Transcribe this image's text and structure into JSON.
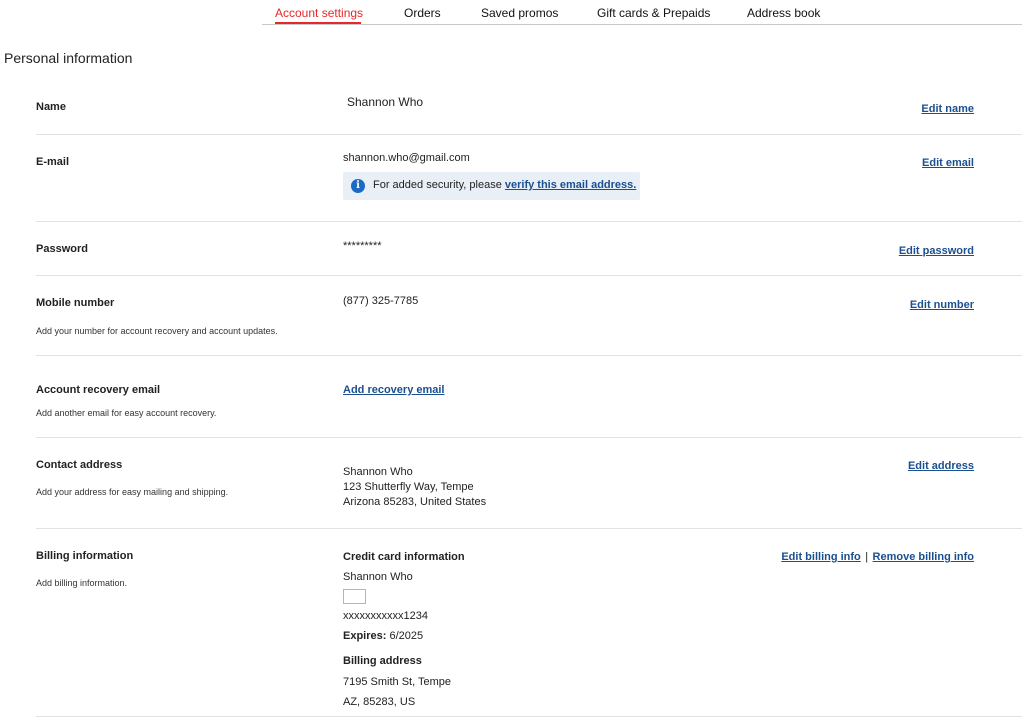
{
  "tabs": [
    {
      "label": "Account settings",
      "active": true
    },
    {
      "label": "Orders"
    },
    {
      "label": "Saved promos"
    },
    {
      "label": "Gift cards & Prepaids"
    },
    {
      "label": "Address book"
    }
  ],
  "section_title": "Personal information",
  "rows": {
    "name": {
      "label": "Name",
      "value": "Shannon Who",
      "action": "Edit name"
    },
    "email": {
      "label": "E-mail",
      "value": "shannon.who@gmail.com",
      "action": "Edit email",
      "notice_text": "For added security, please",
      "notice_link": "verify this email address."
    },
    "password": {
      "label": "Password",
      "value": "*********",
      "action": "Edit password"
    },
    "mobile": {
      "label": "Mobile number",
      "sub": "Add your number for account recovery and account updates.",
      "value": "(877) 325-7785",
      "action": "Edit number"
    },
    "recovery": {
      "label": "Account recovery email",
      "sub": "Add another email for easy account recovery.",
      "link": "Add recovery email"
    },
    "contact": {
      "label": "Contact address",
      "sub": "Add your address for easy mailing and shipping.",
      "lines": [
        "Shannon Who",
        "123 Shutterfly Way, Tempe",
        "Arizona 85283, United States"
      ],
      "action": "Edit address"
    },
    "billing": {
      "label": "Billing information",
      "sub": "Add billing information.",
      "cc_heading": "Credit card information",
      "cc_name": "Shannon Who",
      "cc_number": "xxxxxxxxxxx1234",
      "expires_label": "Expires:",
      "expires_value": "6/2025",
      "address_heading": "Billing address",
      "address_lines": [
        "7195 Smith St, Tempe",
        "AZ, 85283, US"
      ],
      "edit_action": "Edit billing info",
      "separator": "|",
      "remove_action": "Remove billing info"
    }
  },
  "colors": {
    "accent": "#e8272a",
    "link": "#1b4f8f",
    "info": "#1b6bc2",
    "notice_bg": "#e8eff6"
  }
}
